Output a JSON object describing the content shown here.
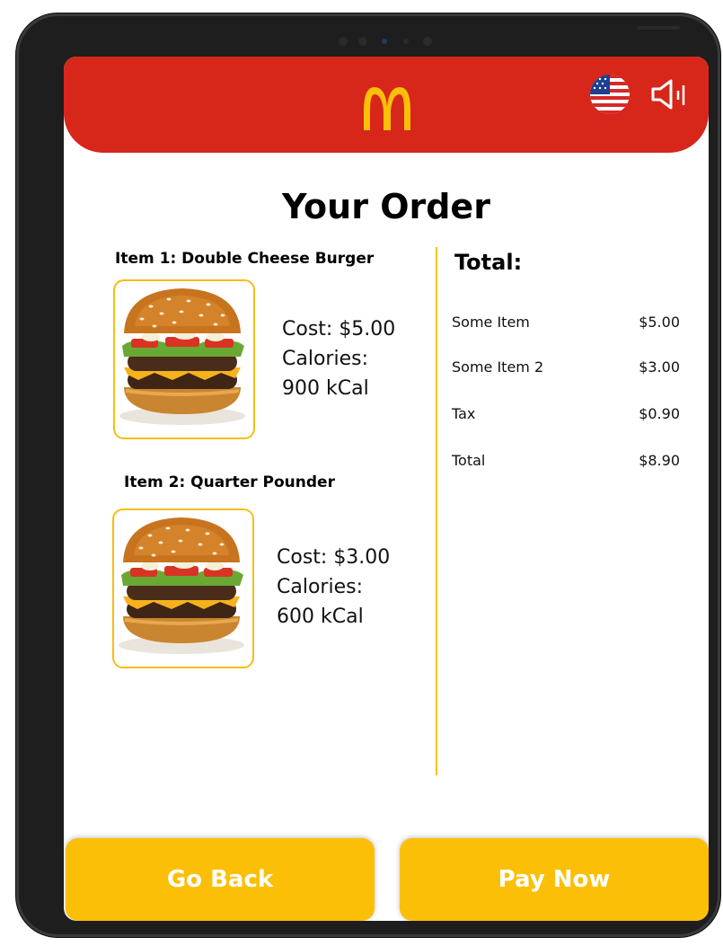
{
  "header": {
    "logo_icon": "golden-arches-logo",
    "language_icon": "us-flag-icon",
    "sound_icon": "speaker-icon",
    "brand_color": "#d7261a"
  },
  "page": {
    "title": "Your Order"
  },
  "items": [
    {
      "title": "Item 1: Double Cheese Burger",
      "cost": "Cost: $5.00",
      "calories_label": "Calories:",
      "calories_value": "900 kCal"
    },
    {
      "title": "Item 2: Quarter Pounder",
      "cost": "Cost: $3.00",
      "calories_label": "Calories:",
      "calories_value": "600 kCal"
    }
  ],
  "totals": {
    "title": "Total:",
    "rows": [
      {
        "name": "Some Item",
        "amount": "$5.00"
      },
      {
        "name": "Some Item 2",
        "amount": "$3.00"
      },
      {
        "name": "Tax",
        "amount": "$0.90"
      },
      {
        "name": "Total",
        "amount": "$8.90"
      }
    ]
  },
  "actions": {
    "back_label": "Go Back",
    "pay_label": "Pay Now",
    "accent_color": "#fcbf08"
  }
}
